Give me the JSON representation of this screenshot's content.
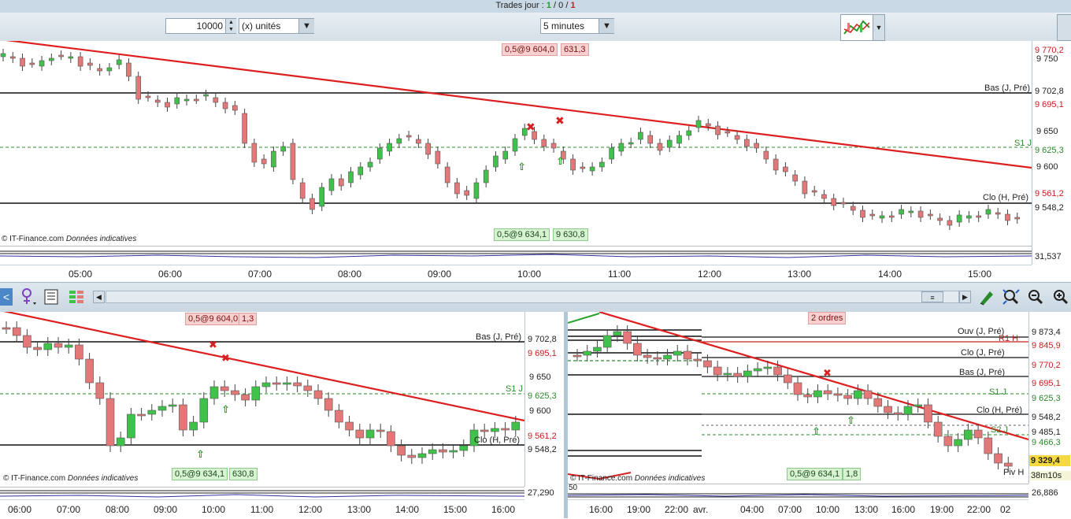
{
  "header": {
    "trades_prefix": "Trades jour : ",
    "trades_a": "1",
    "trades_sep1": " / ",
    "trades_b": "0",
    "trades_sep2": " / ",
    "trades_c": "1"
  },
  "toolbar": {
    "quantity": "10000",
    "unit": "(x) unités",
    "timeframe": "5 minutes"
  },
  "top_chart": {
    "tag_sell": "0,5@9 604,0",
    "tag_sell_right": "631,3",
    "tag_buy": "0,5@9 634,1",
    "tag_buy_right": "9 630,8",
    "label_bas": "Bas (J, Pré)",
    "label_s1": "S1 J",
    "label_clo": "Clo (H, Pré)",
    "credit": "© IT-Finance.com",
    "credit_note": "Données indicatives",
    "axis_prices": [
      "9 750",
      "9 650",
      "9 600"
    ],
    "price_770": "9 770,2",
    "price_702": "9 702,8",
    "price_695": "9 695,1",
    "price_625": "9 625,3",
    "price_561": "9 561,2",
    "price_548": "9 548,2",
    "osc_value": "31,537",
    "time_ticks": [
      "05:00",
      "06:00",
      "07:00",
      "08:00",
      "09:00",
      "10:00",
      "11:00",
      "12:00",
      "13:00",
      "14:00",
      "15:00"
    ]
  },
  "left_chart": {
    "tag_sell": "0,5@9 604,0",
    "tag_sell_right": "1,3",
    "tag_buy": "0,5@9 634,1",
    "tag_buy_right": "630,8",
    "label_bas": "Bas (J, Pré)",
    "label_s1": "S1 J",
    "label_clo": "Clo (H, Pré)",
    "credit": "© IT-Finance.com",
    "credit_note": "Données indicatives",
    "price_702": "9 702,8",
    "price_695": "9 695,1",
    "price_650": "9 650",
    "price_625": "9 625,3",
    "price_600": "9 600",
    "price_561": "9 561,2",
    "price_548": "9 548,2",
    "osc_value": "27,290",
    "time_ticks": [
      "06:00",
      "07:00",
      "08:00",
      "09:00",
      "10:00",
      "11:00",
      "12:00",
      "13:00",
      "14:00",
      "15:00",
      "16:00"
    ]
  },
  "right_chart": {
    "tag_orders": "2 ordres",
    "tag_buy": "0,5@9 634,1",
    "tag_buy_right": "1,8",
    "label_ouv": "Ouv (J, Pré)",
    "label_r1": "R1 H",
    "label_clo_j": "Clo (J, Pré)",
    "label_bas": "Bas (J, Pré)",
    "label_s1": "S1 J",
    "label_clo_h": "Clo (H, Pré)",
    "label_s2": "S2 J",
    "label_piv": "Piv H",
    "credit": "© IT-Finance.com",
    "credit_note": "Données indicatives",
    "price_873": "9 873,4",
    "price_845": "9 845,9",
    "price_770": "9 770,2",
    "price_695": "9 695,1",
    "price_625": "9 625,3",
    "price_548": "9 548,2",
    "price_485": "9 485,1",
    "price_466": "9 466,3",
    "price_329": "9 329,4",
    "countdown": "38m10s",
    "osc_value": "26,886",
    "osc_level": "50",
    "time_ticks": [
      "16:00",
      "19:00",
      "22:00",
      "avr.",
      "04:00",
      "07:00",
      "10:00",
      "13:00",
      "16:00",
      "19:00",
      "22:00",
      "02"
    ]
  },
  "colors": {
    "up": "#3fc24a",
    "down": "#e47878",
    "trend": "#dd1f1f",
    "support": "#2b8a2b"
  }
}
